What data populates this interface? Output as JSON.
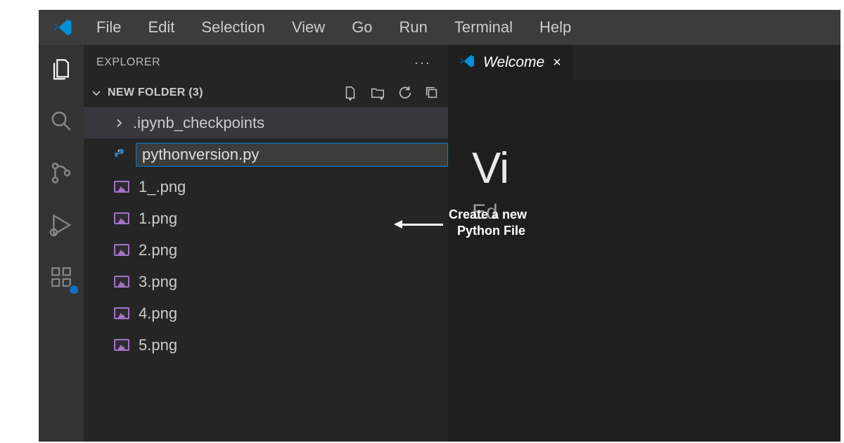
{
  "menu": {
    "items": [
      "File",
      "Edit",
      "Selection",
      "View",
      "Go",
      "Run",
      "Terminal",
      "Help"
    ]
  },
  "sidebar": {
    "title": "EXPLORER",
    "more": "···",
    "folder_name": "NEW FOLDER (3)",
    "new_file_value": "pythonversion.py",
    "tree": {
      "folder1": ".ipynb_checkpoints",
      "f1": "1_.png",
      "f2": "1.png",
      "f3": "2.png",
      "f4": "3.png",
      "f5": "4.png",
      "f6": "5.png"
    }
  },
  "tab": {
    "label": "Welcome",
    "close": "×"
  },
  "editor": {
    "heading": "Vi",
    "sub": "Ed"
  },
  "annotation": {
    "text": "Create a new\n  Python File"
  }
}
